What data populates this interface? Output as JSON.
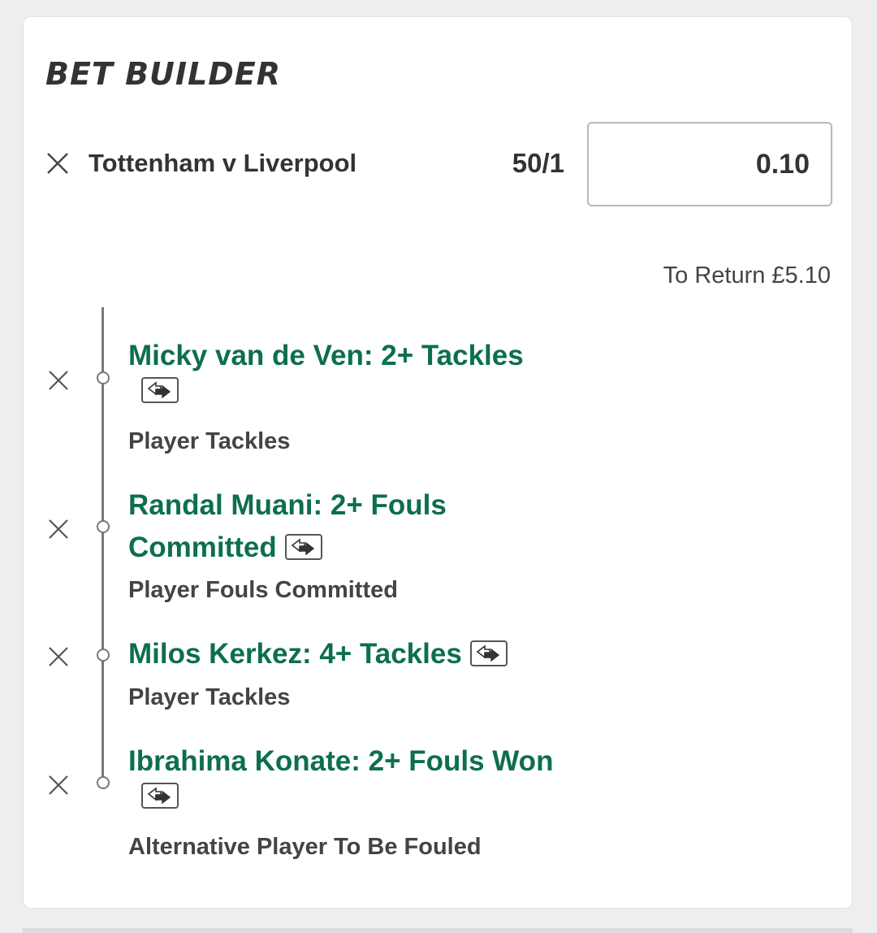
{
  "bet_builder": {
    "title": "BET BUILDER",
    "match": "Tottenham v Liverpool",
    "odds": "50/1",
    "stake": "0.10",
    "to_return": "To Return £5.10",
    "selections": [
      {
        "title": "Micky van de Ven: 2+ Tackles",
        "market": "Player Tackles"
      },
      {
        "title": "Randal Muani: 2+ Fouls Committed",
        "market": "Player Fouls Committed"
      },
      {
        "title": "Milos Kerkez: 4+ Tackles",
        "market": "Player Tackles"
      },
      {
        "title": "Ibrahima Konate: 2+ Fouls Won",
        "market": "Alternative Player To Be Fouled"
      }
    ]
  },
  "colors": {
    "selection_green": "#0d6f4b",
    "text_dark": "#333333",
    "background": "#eeeeee"
  },
  "icons": {
    "remove": "close-icon",
    "swap": "swap-arrows-icon"
  }
}
